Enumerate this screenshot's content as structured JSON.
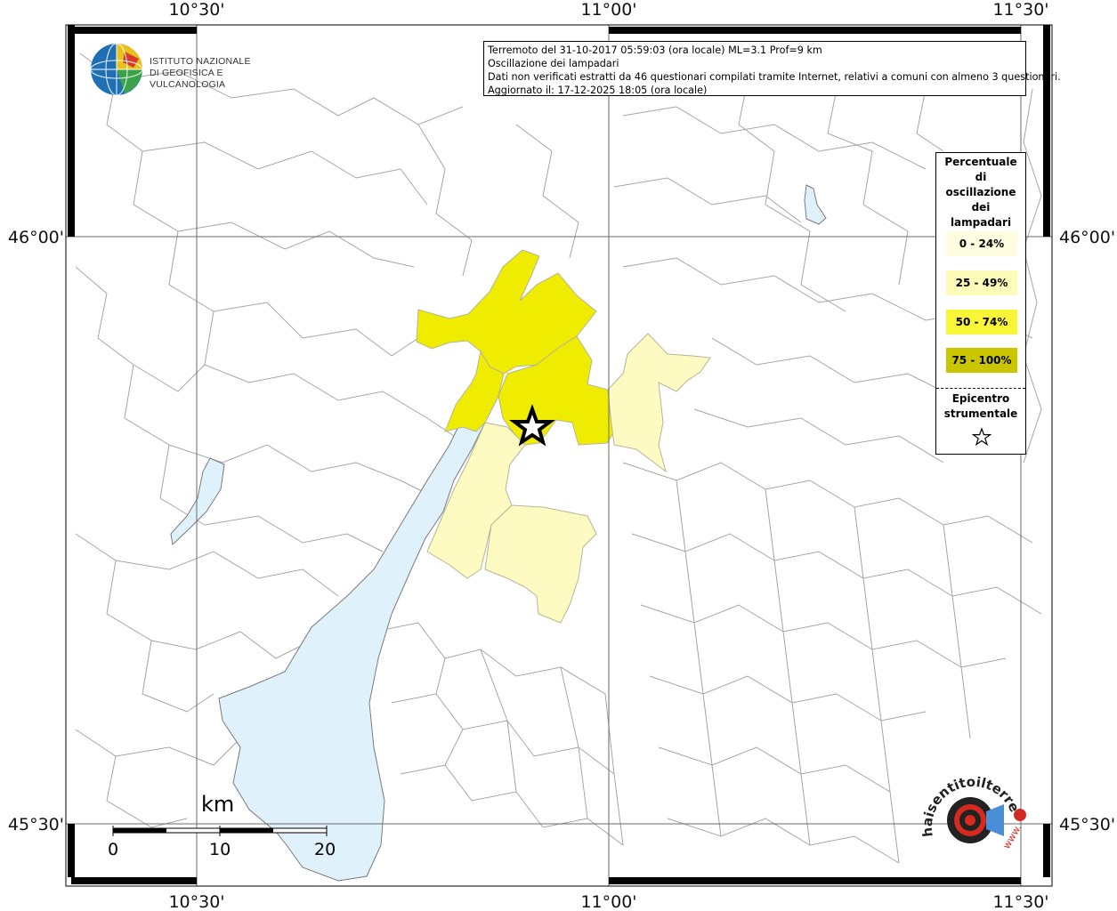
{
  "map": {
    "coords": {
      "lon_left": "10°30'",
      "lon_mid": "11°00'",
      "lon_right": "11°30'",
      "lat_top": "46°00'",
      "lat_bottom": "45°30'"
    },
    "colors": {
      "lake": "#dff1fb",
      "border": "#9a9a9a",
      "class_0_24": "#fffccc",
      "class_25_49": "#fdfcc0",
      "class_50_74": "#f2ef00",
      "class_75_100": "#c8c400"
    }
  },
  "info": {
    "line1": "Terremoto del 31-10-2017 05:59:03 (ora locale) ML=3.1 Prof=9 km",
    "line2": "Oscillazione dei lampadari",
    "line3": "Dati non verificati estratti da 46 questionari compilati tramite Internet, relativi a comuni con almeno 3 questionari.",
    "line4": "Aggiornato il: 17-12-2025 18:05 (ora locale)"
  },
  "legend": {
    "title_1": "Percentuale",
    "title_2": "di",
    "title_3": "oscillazione",
    "title_4": "dei",
    "title_5": "lampadari",
    "items": [
      {
        "label": "0 - 24%",
        "color": "#fffde0"
      },
      {
        "label": "25 - 49%",
        "color": "#fdfcb8"
      },
      {
        "label": "50 - 74%",
        "color": "#f9f638"
      },
      {
        "label": "75 - 100%",
        "color": "#c9c600"
      }
    ],
    "epicenter_1": "Epicentro",
    "epicenter_2": "strumentale"
  },
  "logo": {
    "line1": "ISTITUTO NAZIONALE",
    "line2": "DI GEOFISICA E VULCANOLOGIA"
  },
  "scale": {
    "unit": "km",
    "label_0": "0",
    "label_10": "10",
    "label_20": "20"
  },
  "hst_logo": {
    "text": "haisentitoilterremoto.it",
    "www": "www."
  }
}
